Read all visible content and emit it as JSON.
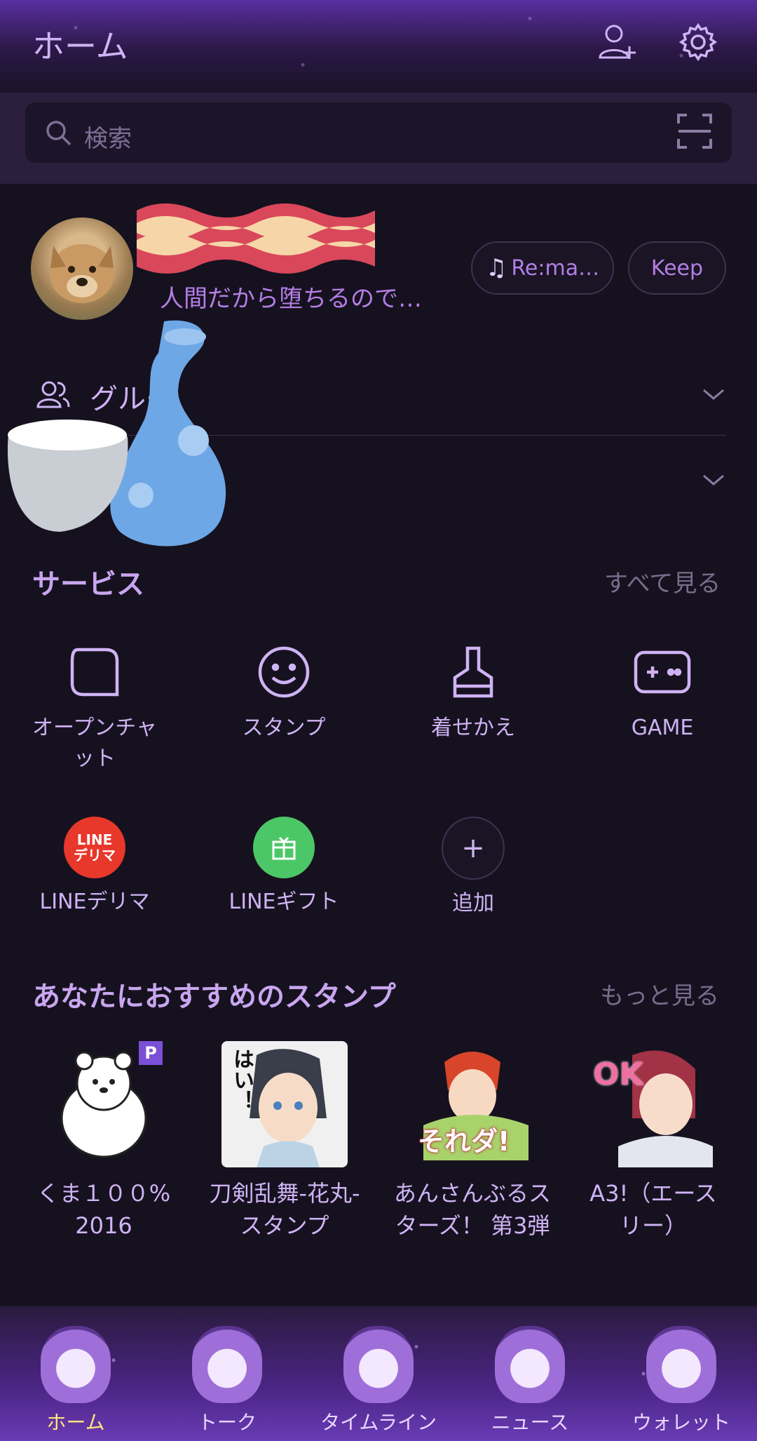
{
  "header": {
    "title": "ホーム"
  },
  "search": {
    "placeholder": "検索"
  },
  "profile": {
    "status": "人間だから堕ちるので…",
    "music_pill": "Re:ma…",
    "keep_pill": "Keep"
  },
  "groups": {
    "label": "グルー"
  },
  "services": {
    "title": "サービス",
    "see_all": "すべて見る",
    "items": [
      {
        "label": "オープンチャ\nット",
        "icon": "open-chat-icon"
      },
      {
        "label": "スタンプ",
        "icon": "smile-icon"
      },
      {
        "label": "着せかえ",
        "icon": "brush-icon"
      },
      {
        "label": "GAME",
        "icon": "gamepad-icon"
      },
      {
        "label": "LINEデリマ",
        "icon": "line-delima-icon",
        "badge_text": "LINE\nデリマ"
      },
      {
        "label": "LINEギフト",
        "icon": "gift-icon"
      },
      {
        "label": "追加",
        "icon": "plus-icon"
      }
    ]
  },
  "stamps": {
    "title": "あなたにおすすめのスタンプ",
    "more": "もっと見る",
    "items": [
      {
        "label": "くま１００%\n2016",
        "badge": "P"
      },
      {
        "label": "刀剣乱舞-花丸-\nスタンプ",
        "art_text": "はい！"
      },
      {
        "label": "あんさんぶるス\nターズ！ 第3弾",
        "art_text": "それダ!"
      },
      {
        "label": "A3!（エース\nリー）",
        "art_text": "OK"
      }
    ]
  },
  "nav": {
    "items": [
      {
        "label": "ホーム",
        "active": true
      },
      {
        "label": "トーク"
      },
      {
        "label": "タイムライン"
      },
      {
        "label": "ニュース"
      },
      {
        "label": "ウォレット"
      }
    ]
  },
  "colors": {
    "accent": "#b47ee6",
    "background": "#16111f",
    "line_red": "#e8372b",
    "gift_green": "#4cc767"
  }
}
